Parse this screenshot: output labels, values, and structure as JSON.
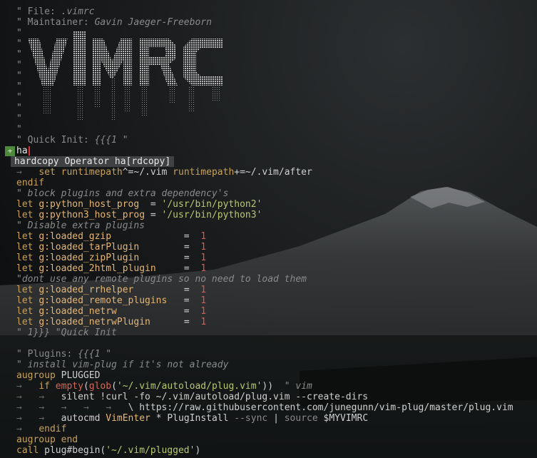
{
  "colors": {
    "background": "#0f1112",
    "comment": "#8a8a8a",
    "keyword": "#c9a15a",
    "variable": "#e6b673",
    "string": "#b8c770",
    "number": "#e05a4a",
    "popup_bg": "#3f4142",
    "sign": "#4e8a3e",
    "cursor": "#dd3333"
  },
  "header": {
    "file_label": "\" File: ",
    "file_value": ".vimrc",
    "maintainer_label": "\" Maintainer: ",
    "maintainer_value": "Gavin Jaeger-Freeborn",
    "quote": "\"",
    "ascii_art_word": "VIMRC"
  },
  "quick_init": {
    "label": "\" Quick Init: ",
    "fold": "{{{1 \""
  },
  "cursor_line": {
    "sign": "+",
    "typed": "ha"
  },
  "completion_popup": {
    "item": "hardcopy Operator ha[rdcopy]"
  },
  "code": {
    "arrow": "→",
    "set_kw": "set",
    "rtp1": "runtimepath",
    "rtp_op1": "^=~/.vim ",
    "rtp2": "runtimepath",
    "rtp_op2": "+=~/.vim/after",
    "endif": "endif",
    "c_block": "\" block plugins and extra dependency's",
    "let": "let",
    "py2_var": "g:python_host_prog",
    "py2_eq": "  = ",
    "py2_val": "'/usr/bin/python2'",
    "py3_var": "g:python3_host_prog",
    "py3_eq": " = ",
    "py3_val": "'/usr/bin/python3'",
    "c_disable": "\" Disable extra plugins",
    "loaded": [
      {
        "name": "g:loaded_gzip",
        "pad": "             =  ",
        "value": "1"
      },
      {
        "name": "g:loaded_tarPlugin",
        "pad": "        =  ",
        "value": "1"
      },
      {
        "name": "g:loaded_zipPlugin",
        "pad": "        =  ",
        "value": "1"
      },
      {
        "name": "g:loaded_2html_plugin",
        "pad": "     =  ",
        "value": "1"
      }
    ],
    "c_remote": "\"dont use any remote plugins so no need to load them",
    "loaded2": [
      {
        "name": "g:loaded_rrhelper",
        "pad": "         =  ",
        "value": "1"
      },
      {
        "name": "g:loaded_remote_plugins",
        "pad": "   =  ",
        "value": "1"
      },
      {
        "name": "g:loaded_netrw",
        "pad": "            =  ",
        "value": "1"
      },
      {
        "name": "g:loaded_netrwPlugin",
        "pad": "      =  ",
        "value": "1"
      }
    ],
    "fold_end": "\" 1}}} \"Quick Init",
    "plugins_label": "\" Plugins: ",
    "plugins_fold": "{{{1 \"",
    "c_install": "\" install vim-plug if it's not already",
    "augroup": "augroup",
    "augroup_name": " PLUGGED",
    "if_kw": "if",
    "empty_fn": "empty",
    "glob_fn": "glob",
    "glob_arg": "'~/.vim/autoload/plug.vim'",
    "if_close": "))",
    "if_comment": "\" vim",
    "silent": "silent !curl -fo ~/.vim/autoload/plug.vim --create-dirs",
    "backslash_line": "\\ https://raw.githubusercontent.com/junegunn/vim-plug/master/plug.vim",
    "autocmd": "autocmd",
    "vimenter": "VimEnter",
    "autocmd_rest": " * PlugInstall ",
    "sync": "--sync",
    "pipe": " | ",
    "source": "source",
    "myvimrc": " $MYVIMRC",
    "endif2": "endif",
    "augroup_end": "augroup end",
    "call": "call",
    "plug_begin": " plug#begin(",
    "plug_arg": "'~/.vim/plugged'",
    "plug_close": ")"
  }
}
